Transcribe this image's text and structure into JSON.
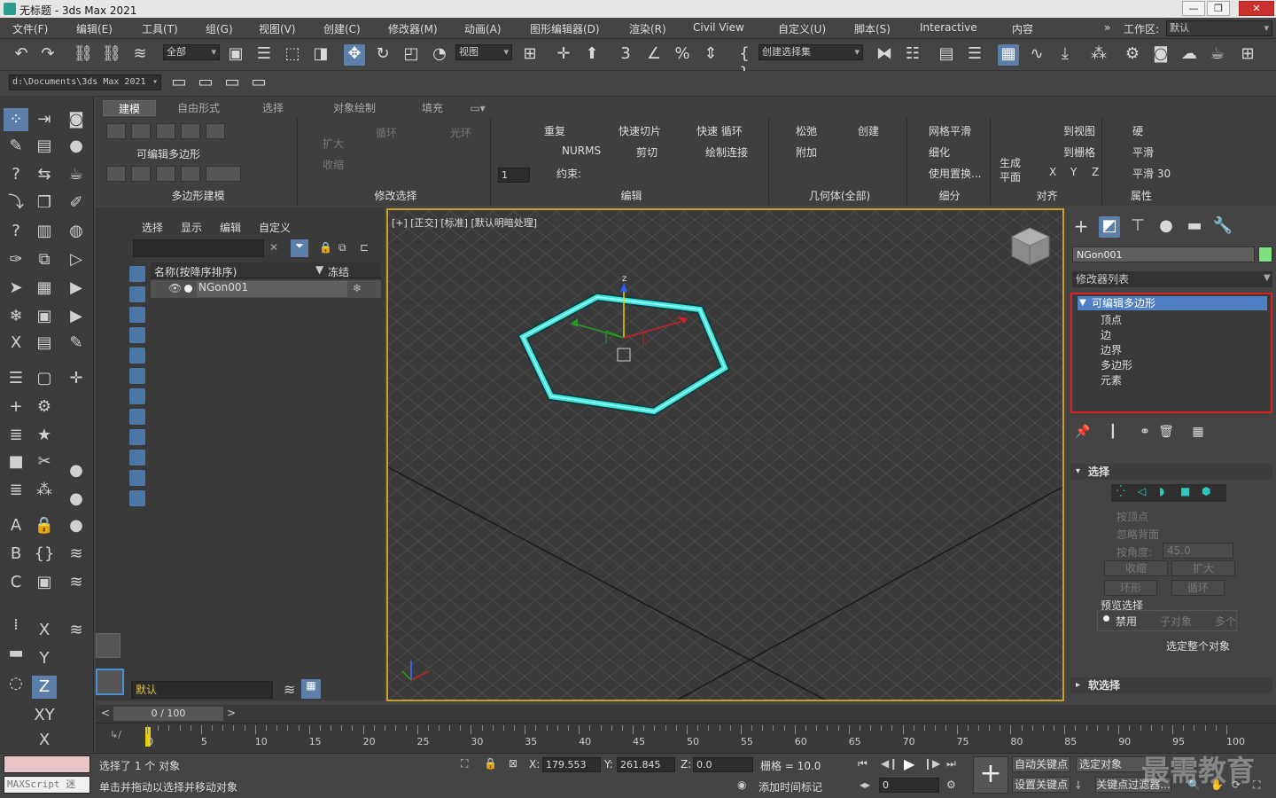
{
  "window": {
    "title": "无标题 - 3ds Max 2021"
  },
  "menu": [
    "文件(F)",
    "编辑(E)",
    "工具(T)",
    "组(G)",
    "视图(V)",
    "创建(C)",
    "修改器(M)",
    "动画(A)",
    "图形编辑器(D)",
    "渲染(R)",
    "Civil View",
    "自定义(U)",
    "脚本(S)",
    "Interactive",
    "内容"
  ],
  "workspace": {
    "label": "工作区:",
    "value": "默认"
  },
  "toolbar": {
    "filter": "全部",
    "ref_coord": "视图",
    "named_sel": "创建选择集",
    "path": "d:\\Documents\\3ds Max 2021"
  },
  "ribbon": {
    "tabs": [
      "建模",
      "自由形式",
      "选择",
      "对象绘制",
      "填充"
    ],
    "poly_label": "可编辑多边形",
    "panels": {
      "poly_model": "多边形建模",
      "modify_sel": "修改选择",
      "edit": "编辑",
      "geometry": "几何体(全部)",
      "subdiv": "细分",
      "align": "对齐",
      "props": "属性"
    },
    "sel_buttons": {
      "grow": "扩大",
      "shrink": "收缩",
      "loop": "循环",
      "ring": "光环"
    },
    "edit_buttons": {
      "repeat": "重复",
      "quickslice": "快速切片",
      "quickloop": "快速 循环",
      "nurms": "NURMS",
      "cut": "剪切",
      "paintconn": "绘制连接",
      "constraint": "约束:",
      "spin_value": "1"
    },
    "geom_buttons": {
      "relax": "松弛",
      "create": "创建",
      "attach": "附加"
    },
    "subdiv_buttons": {
      "meshsmooth": "网格平滑",
      "tessellate": "细化",
      "usedisp": "使用置换..."
    },
    "align_buttons": {
      "genplane": "生成",
      "genplane2": "平面",
      "toview": "到视图",
      "togrid": "到栅格",
      "x": "X",
      "y": "Y",
      "z": "Z"
    },
    "prop_buttons": {
      "hard": "硬",
      "smooth": "平滑",
      "smooth30": "平滑 30"
    }
  },
  "scene_explorer": {
    "menu": [
      "选择",
      "显示",
      "编辑",
      "自定义"
    ],
    "col_name": "名称(按降序排序)",
    "col_freeze": "冻结",
    "object": "NGon001",
    "layer": "默认"
  },
  "viewport": {
    "label": "[+] [正交] [标准] [默认明暗处理]",
    "axis_z": "z"
  },
  "command_panel": {
    "object_name": "NGon001",
    "modifier_list": "修改器列表",
    "stack_root": "可编辑多边形",
    "stack_items": [
      "顶点",
      "边",
      "边界",
      "多边形",
      "元素"
    ],
    "selection": {
      "title": "选择",
      "by_vertex": "按顶点",
      "ignore_back": "忽略背面",
      "by_angle": "按角度:",
      "angle_value": "45.0",
      "shrink": "收缩",
      "grow": "扩大",
      "ring": "环形",
      "loop": "循环",
      "preview": "预览选择",
      "disabled": "禁用",
      "subobj": "子对象",
      "multi": "多个",
      "whole": "选定整个对象"
    },
    "soft_selection": "软选择"
  },
  "timeline": {
    "frame": "0 / 100",
    "ticks": [
      "0",
      "5",
      "10",
      "15",
      "20",
      "25",
      "30",
      "35",
      "40",
      "45",
      "50",
      "55",
      "60",
      "65",
      "70",
      "75",
      "80",
      "85",
      "90",
      "95",
      "100"
    ]
  },
  "status": {
    "maxscript": "MAXScript 迷",
    "selected": "选择了 1 个 对象",
    "prompt": "单击并拖动以选择并移动对象",
    "x_label": "X:",
    "x": "179.553",
    "y_label": "Y:",
    "y": "261.845",
    "z_label": "Z:",
    "z": "0.0",
    "grid": "栅格 = 10.0",
    "add_time_tag": "添加时间标记",
    "auto_key": "自动关键点",
    "set_key": "设置关键点",
    "sel_obj": "选定对象",
    "key_filters": "关键点过滤器...",
    "frame_value": "0",
    "watermark": "最需教育"
  }
}
